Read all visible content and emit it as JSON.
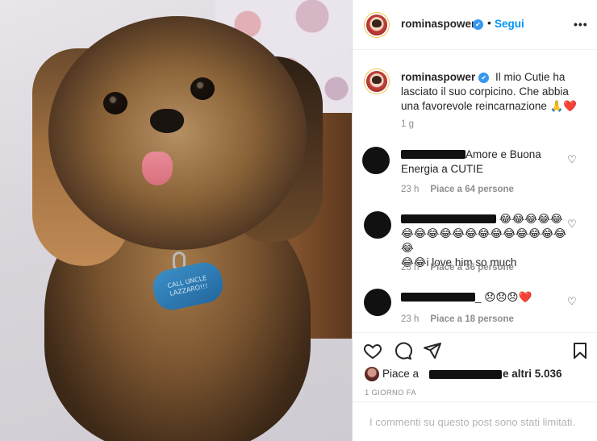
{
  "post": {
    "username": "rominaspower",
    "follow_label": "Segui",
    "more_label": "•••",
    "caption": "Il mio Cutie ha lasciato il suo corpicino. Che abbia una favorevole reincarnazione 🙏❤️",
    "caption_time": "1 g",
    "dog_tag_text": "CALL UNCLE LAZZARO!!!"
  },
  "comments": [
    {
      "text": "Amore e Buona Energia a CUTIE",
      "time": "23 h",
      "likes": "Piace a 64 persone"
    },
    {
      "text_prefix": "😂😂😂😂😂",
      "text_line2": "😂😂😂😂😂😂😂😂😂😂😂😂😂😂",
      "text_line3": "😂😂i love him so much",
      "time": "23 h",
      "likes": "Piace a 36 persone"
    },
    {
      "text": "_ 😞😞😞❤️",
      "time": "23 h",
      "likes": "Piace a 18 persone"
    }
  ],
  "likes": {
    "prefix": "Piace a",
    "suffix": "e altri 5.036"
  },
  "time_ago": "1 GIORNO FA",
  "comments_limited": "I commenti su questo post sono stati limitati.",
  "icons": {
    "verified": "verified-badge-icon",
    "like": "heart-icon",
    "comment": "comment-icon",
    "share": "paper-plane-icon",
    "save": "bookmark-icon"
  },
  "colors": {
    "link_blue": "#0095f6",
    "verified_blue": "#3897f0",
    "muted_text": "#8e8e8e"
  }
}
